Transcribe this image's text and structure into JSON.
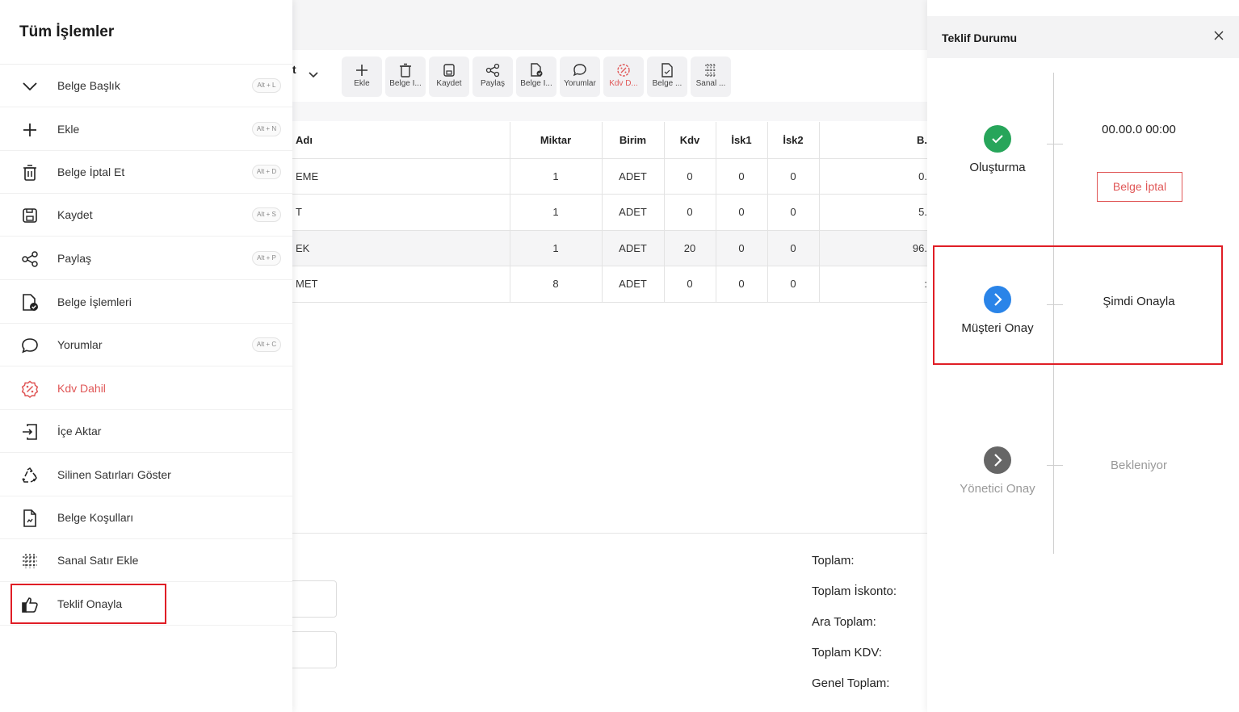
{
  "sidebar": {
    "title": "Tüm İşlemler",
    "items": [
      {
        "label": "Belge Başlık",
        "shortcut": "Alt + L",
        "icon": "chevron-down-icon"
      },
      {
        "label": "Ekle",
        "shortcut": "Alt + N",
        "icon": "plus-icon"
      },
      {
        "label": "Belge İptal Et",
        "shortcut": "Alt + D",
        "icon": "trash-icon"
      },
      {
        "label": "Kaydet",
        "shortcut": "Alt + S",
        "icon": "save-icon"
      },
      {
        "label": "Paylaş",
        "shortcut": "Alt + P",
        "icon": "share-icon"
      },
      {
        "label": "Belge İşlemleri",
        "shortcut": "",
        "icon": "document-check-icon"
      },
      {
        "label": "Yorumlar",
        "shortcut": "Alt + C",
        "icon": "comment-icon"
      },
      {
        "label": "Kdv Dahil",
        "shortcut": "",
        "icon": "percent-badge-icon"
      },
      {
        "label": "İçe Aktar",
        "shortcut": "",
        "icon": "import-icon"
      },
      {
        "label": "Silinen Satırları Göster",
        "shortcut": "",
        "icon": "recycle-icon"
      },
      {
        "label": "Belge Koşulları",
        "shortcut": "",
        "icon": "document-terms-icon"
      },
      {
        "label": "Sanal Satır Ekle",
        "shortcut": "",
        "icon": "grid-add-icon"
      },
      {
        "label": "Teklif Onayla",
        "shortcut": "",
        "icon": "thumbs-up-icon"
      }
    ]
  },
  "toolbar": {
    "doc_selector": "t",
    "buttons": [
      {
        "label": "Ekle",
        "icon": "plus-icon"
      },
      {
        "label": "Belge İ...",
        "icon": "trash-icon"
      },
      {
        "label": "Kaydet",
        "icon": "save-icon"
      },
      {
        "label": "Paylaş",
        "icon": "share-icon"
      },
      {
        "label": "Belge İ...",
        "icon": "document-check-icon"
      },
      {
        "label": "Yorumlar",
        "icon": "comment-icon"
      },
      {
        "label": "Kdv D...",
        "icon": "percent-badge-icon"
      },
      {
        "label": "Belge ...",
        "icon": "document-terms-icon"
      },
      {
        "label": "Sanal ...",
        "icon": "grid-add-icon"
      }
    ]
  },
  "table": {
    "headers": {
      "name": "Adı",
      "qty": "Miktar",
      "unit": "Birim",
      "kdv": "Kdv",
      "isk1": "İsk1",
      "isk2": "İsk2",
      "b": "B."
    },
    "rows": [
      {
        "name": "EME",
        "qty": "1",
        "unit": "ADET",
        "kdv": "0",
        "isk1": "0",
        "isk2": "0",
        "b": "0."
      },
      {
        "name": "T",
        "qty": "1",
        "unit": "ADET",
        "kdv": "0",
        "isk1": "0",
        "isk2": "0",
        "b": "5."
      },
      {
        "name": "EK",
        "qty": "1",
        "unit": "ADET",
        "kdv": "20",
        "isk1": "0",
        "isk2": "0",
        "b": "96."
      },
      {
        "name": "MET",
        "qty": "8",
        "unit": "ADET",
        "kdv": "0",
        "isk1": "0",
        "isk2": "0",
        "b": ":"
      }
    ]
  },
  "totals": {
    "toplam": "Toplam:",
    "toplam_iskonto": "Toplam İskonto:",
    "ara_toplam": "Ara Toplam:",
    "toplam_kdv": "Toplam KDV:",
    "genel_toplam": "Genel Toplam:"
  },
  "status_panel": {
    "title": "Teklif Durumu",
    "steps": [
      {
        "label": "Oluşturma",
        "status": "00.00.0 00:00",
        "state": "done",
        "color": "#27a55a"
      },
      {
        "label": "Müşteri Onay",
        "status": "Şimdi Onayla",
        "state": "active",
        "color": "#2a84e8"
      },
      {
        "label": "Yönetici Onay",
        "status": "Bekleniyor",
        "state": "pending",
        "color": "#666666"
      }
    ],
    "cancel_button": "Belge İptal"
  },
  "colors": {
    "accent_red": "#e05757",
    "highlight": "#e01e26"
  }
}
